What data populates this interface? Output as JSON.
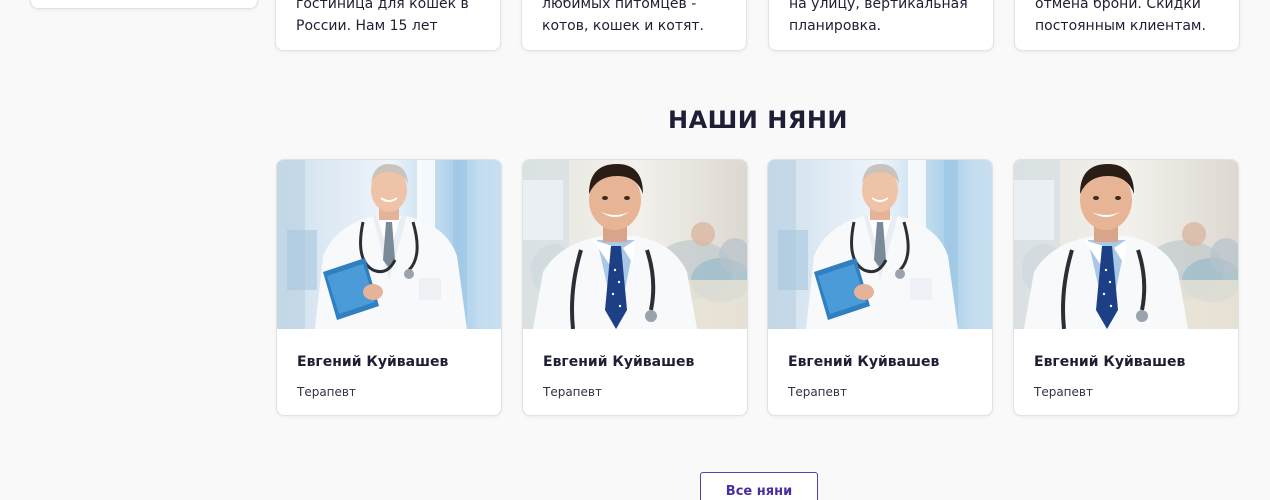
{
  "feature_cards": [
    {
      "lines": [
        "гостиница для кошек в",
        "России. Нам 15 лет"
      ]
    },
    {
      "lines": [
        "любимых питомцев -",
        "котов, кошек и котят."
      ]
    },
    {
      "lines": [
        "на улицу, вертикальная",
        "планировка."
      ]
    },
    {
      "lines": [
        "отмена брони. Скидки",
        "постоянным клиентам."
      ]
    }
  ],
  "nannies_section": {
    "title": "НАШИ НЯНИ",
    "cards": [
      {
        "name": "Евгений Куйвашев",
        "role": "Терапевт",
        "photo": "doctor-with-folder"
      },
      {
        "name": "Евгений Куйвашев",
        "role": "Терапевт",
        "photo": "doctor-with-stethoscope"
      },
      {
        "name": "Евгений Куйвашев",
        "role": "Терапевт",
        "photo": "doctor-with-folder"
      },
      {
        "name": "Евгений Куйвашев",
        "role": "Терапевт",
        "photo": "doctor-with-stethoscope"
      }
    ],
    "all_button_label": "Все няни"
  },
  "colors": {
    "page_background": "#f9f9f9",
    "card_background": "#ffffff",
    "accent": "#4a2f9c",
    "text": "#1f1f33"
  }
}
